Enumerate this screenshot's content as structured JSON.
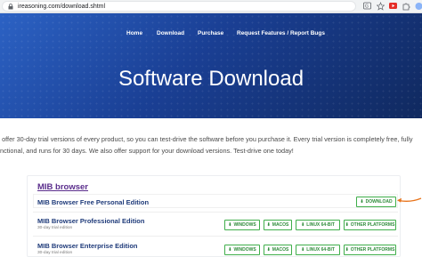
{
  "browser": {
    "url": "ireasoning.com/download.shtml",
    "icons": [
      "lock-icon",
      "translate-icon",
      "star-icon",
      "youtube-icon",
      "extensions-icon",
      "profile-icon"
    ]
  },
  "nav": {
    "home": "Home",
    "download": "Download",
    "purchase": "Purchase",
    "requests": "Request Features / Report Bugs"
  },
  "hero": {
    "title": "Software Download",
    "gradient": [
      "#2c62c4",
      "#1a3f94",
      "#10295f"
    ]
  },
  "intro": {
    "line1": "e offer 30-day trial versions of every product, so you can test-drive the software before you purchase it. Every trial version is completely free, fully",
    "line2": "unctional, and runs for 30 days. We also offer support for your download versions. Test-drive one today!"
  },
  "products": {
    "section_title": "MIB browser",
    "items": [
      {
        "name": "MIB Browser Free Personal Edition",
        "subtitle": "",
        "buttons": [
          "DOWNLOAD"
        ]
      },
      {
        "name": "MIB Browser Professional Edition",
        "subtitle": "30-day trial edition",
        "buttons": [
          "WINDOWS",
          "MACOS",
          "LINUX 64-BIT",
          "OTHER PLATFORMS"
        ]
      },
      {
        "name": "MIB Browser Enterprise Edition",
        "subtitle": "30-day trial edition",
        "buttons": [
          "WINDOWS",
          "MACOS",
          "LINUX 64-BIT",
          "OTHER PLATFORMS"
        ]
      }
    ]
  },
  "colors": {
    "accent_green": "#3fae4a",
    "title_purple": "#5a2d8c",
    "product_blue": "#1f3b7a",
    "annotation_orange": "#e8731a"
  }
}
